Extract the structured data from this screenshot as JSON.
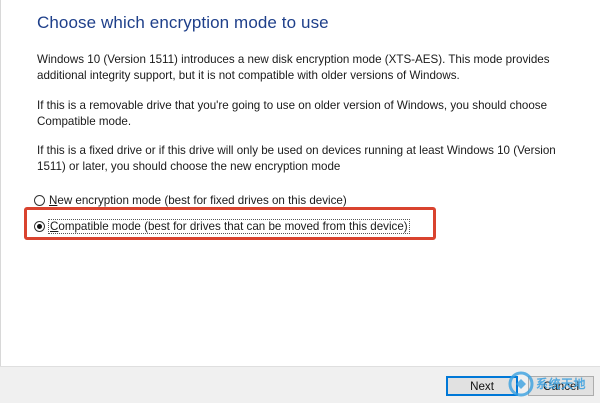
{
  "dialog": {
    "title": "Choose which encryption mode to use",
    "paragraphs": [
      "Windows 10 (Version 1511) introduces a new disk encryption mode (XTS-AES). This mode provides additional integrity support, but it is not compatible with older versions of Windows.",
      "If this is a removable drive that you're going to use on older version of Windows, you should choose Compatible mode.",
      "If this is a fixed drive or if this drive will only be used on devices running at least Windows 10 (Version 1511) or later, you should choose the new encryption mode"
    ],
    "options": [
      {
        "label": "New encryption mode (best for fixed drives on this device)",
        "selected": false
      },
      {
        "label": "Compatible mode (best for drives that can be moved from this device)",
        "selected": true
      }
    ],
    "highlight_color": "#d9432f"
  },
  "footer": {
    "next_label": "Next",
    "cancel_label": "Cancel"
  },
  "watermark": {
    "text": "系统天地"
  }
}
